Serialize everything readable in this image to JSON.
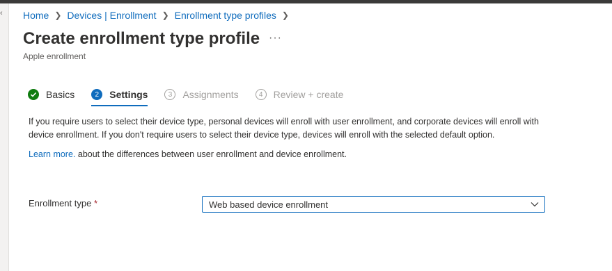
{
  "breadcrumb": {
    "items": [
      "Home",
      "Devices | Enrollment",
      "Enrollment type profiles"
    ]
  },
  "header": {
    "title": "Create enrollment type profile",
    "more": "···",
    "subtitle": "Apple enrollment"
  },
  "steps": [
    {
      "number": "✓",
      "label": "Basics",
      "state": "done"
    },
    {
      "number": "2",
      "label": "Settings",
      "state": "active"
    },
    {
      "number": "3",
      "label": "Assignments",
      "state": "todo"
    },
    {
      "number": "4",
      "label": "Review + create",
      "state": "todo"
    }
  ],
  "settings": {
    "description": "If you require users to select their device type, personal devices will enroll with user enrollment, and corporate devices will enroll with device enrollment. If you don't require users to select their device type, devices will enroll with the selected default option.",
    "learn_more_link": "Learn more.",
    "learn_more_text": " about the differences between user enrollment and device enrollment.",
    "enrollment_type": {
      "label": "Enrollment type",
      "required_marker": "*",
      "value": "Web based device enrollment"
    }
  },
  "colors": {
    "accent": "#0f6cbd",
    "success": "#107c10",
    "required": "#a4262c"
  }
}
